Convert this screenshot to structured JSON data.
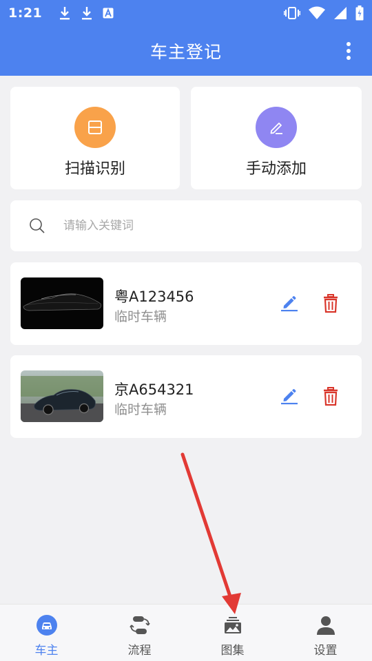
{
  "status_bar": {
    "time": "1:21"
  },
  "app_bar": {
    "title": "车主登记"
  },
  "actions": [
    {
      "label": "扫描识别",
      "color": "#f9a24a"
    },
    {
      "label": "手动添加",
      "color": "#8f86f2"
    }
  ],
  "search": {
    "placeholder": "请输入关键词"
  },
  "vehicles": [
    {
      "plate": "粤A123456",
      "type": "临时车辆"
    },
    {
      "plate": "京A654321",
      "type": "临时车辆"
    }
  ],
  "bottom_nav": [
    {
      "label": "车主",
      "active": true
    },
    {
      "label": "流程",
      "active": false
    },
    {
      "label": "图集",
      "active": false
    },
    {
      "label": "设置",
      "active": false
    }
  ],
  "colors": {
    "primary": "#4d82ef",
    "delete": "#d9362b",
    "annotation_arrow": "#e23a35"
  }
}
